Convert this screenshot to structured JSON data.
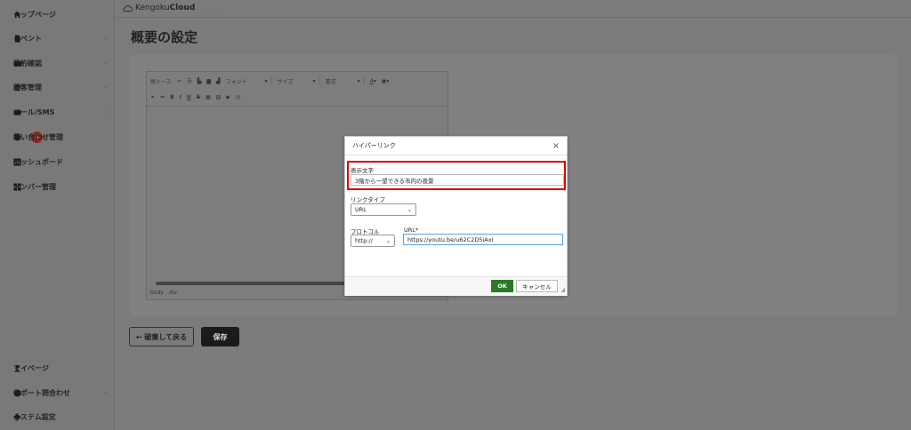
{
  "sidebar": {
    "items": [
      {
        "label": "トップページ",
        "icon": "home-icon",
        "chevron": ""
      },
      {
        "label": "イベント",
        "icon": "document-icon",
        "chevron": "›"
      },
      {
        "label": "予約確認",
        "icon": "card-icon",
        "chevron": "›"
      },
      {
        "label": "顧客管理",
        "icon": "users-icon",
        "chevron": "›"
      },
      {
        "label": "メール/SMS",
        "icon": "mail-icon",
        "chevron": "›"
      },
      {
        "label": "問い合わせ管理",
        "icon": "chat-icon",
        "chevron": "›",
        "badge": "3"
      },
      {
        "label": "ダッシュボード",
        "icon": "chart-icon",
        "chevron": ""
      },
      {
        "label": "メンバー管理",
        "icon": "grid-icon",
        "chevron": ""
      }
    ],
    "bottom_items": [
      {
        "label": "マイページ",
        "icon": "person-icon",
        "chevron": ""
      },
      {
        "label": "サポート問合わせ",
        "icon": "help-icon",
        "chevron": "›"
      },
      {
        "label": "システム設定",
        "icon": "gear-icon",
        "chevron": ""
      }
    ]
  },
  "header": {
    "logo_text_a": "Kengoku",
    "logo_text_b": "Cloud",
    "logo_sub": "........"
  },
  "page": {
    "title": "概要の設定"
  },
  "editor": {
    "source_label": "ソース",
    "font_label": "フォント",
    "size_label": "サイズ",
    "style_label": "書式",
    "status_path": [
      "body",
      "div"
    ]
  },
  "actions": {
    "back_label": "← 破棄して戻る",
    "save_label": "保存"
  },
  "dialog": {
    "title": "ハイパーリンク",
    "close": "×",
    "display_text_label": "表示文字",
    "display_text_value": "3階から一望できる市内の夜景",
    "link_type_label": "リンクタイプ",
    "link_type_value": "URL",
    "protocol_label": "プロトコル",
    "protocol_value": "http://",
    "url_label": "URL*",
    "url_value": "https://youtu.be/u62C2D5iAxI",
    "ok_label": "OK",
    "cancel_label": "キャンセル"
  },
  "colors": {
    "highlight": "#e00000",
    "ok_button": "#2a7a2a",
    "badge": "#8a2a22"
  }
}
